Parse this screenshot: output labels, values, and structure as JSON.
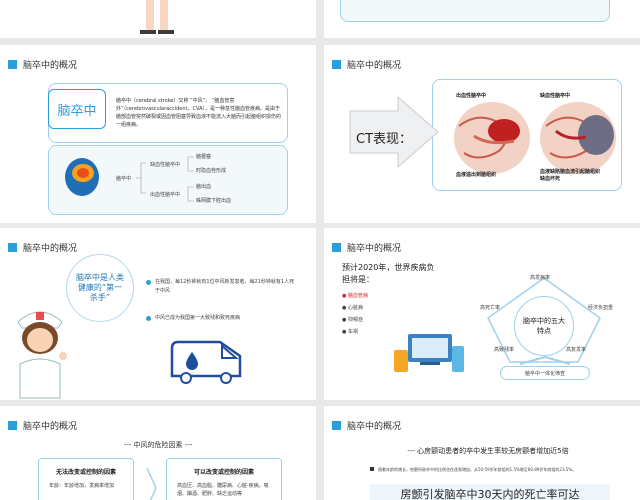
{
  "section_title": "脑卒中的概况",
  "slide2": {
    "term": "脑卒中",
    "definition": "脑卒中（cerebral stroke）又称 “中风”、 “脑血管意外”（cerebrovascularaccident，CVA），是一种急性脑血管疾病。是由于脑部血管突然破裂或因血管阻塞导致血液不能流入大脑而引起脑组织损伤的一组疾病。",
    "types": [
      {
        "name": "缺血性脑卒中",
        "subs": [
          "脑梗塞",
          "时隐血栓形成"
        ]
      },
      {
        "name": "出血性脑卒中",
        "subs": [
          "脑出血",
          "蛛网膜下腔出血"
        ]
      }
    ],
    "branch_label": "脑卒中"
  },
  "slide3": {
    "label": "CT表现：",
    "left_title": "出血性脑卒中",
    "left_caption": "血液溢出到脑组织",
    "right_title": "缺血性脑卒中",
    "right_caption": "血液缺陷脑血流引起脑组织缺血坏死"
  },
  "slide4": {
    "bubble": "脑卒中是人类健康的“第一杀手”",
    "facts": [
      "在我国，每12秒钟就有1位中风新发患者，每21秒钟就有1人死于中风",
      "中风已成为我国第一大致残和致死疾病"
    ]
  },
  "slide5": {
    "intro": "预计2020年，世界疾病负担将是：",
    "diseases": [
      "脑血管病",
      "心脏病",
      "抑郁症",
      "车祸"
    ],
    "pentagon_center": "脑卒中的五大特点",
    "features": [
      "高发病率",
      "经济负担重",
      "高死亡率",
      "高致残率",
      "高复发率"
    ],
    "bottom_caption": "脑卒中一体化筛查"
  },
  "slide6": {
    "risk_title": "中风的危险因素",
    "uncontrollable": {
      "title": "无法改变或控制的因素",
      "text": "年龄：年龄增加，发病率增加"
    },
    "controllable": {
      "title": "可以改变或控制的因素",
      "text": "高血压、高血脂、糖尿病、心脏·疾病，吸烟、酗酒、肥胖、缺乏运动等"
    }
  },
  "slide7": {
    "headline": "心房颤动患者的卒中发生率较无房颤者增加近5倍",
    "note": "随着年龄的增长，房颤所致卒中的比例也在逐渐增加，从50-59岁年龄组的1.5%增至80-89岁年龄组的23.5%。",
    "bottom": "房颤引发脑卒中30天内的死亡率可达"
  }
}
